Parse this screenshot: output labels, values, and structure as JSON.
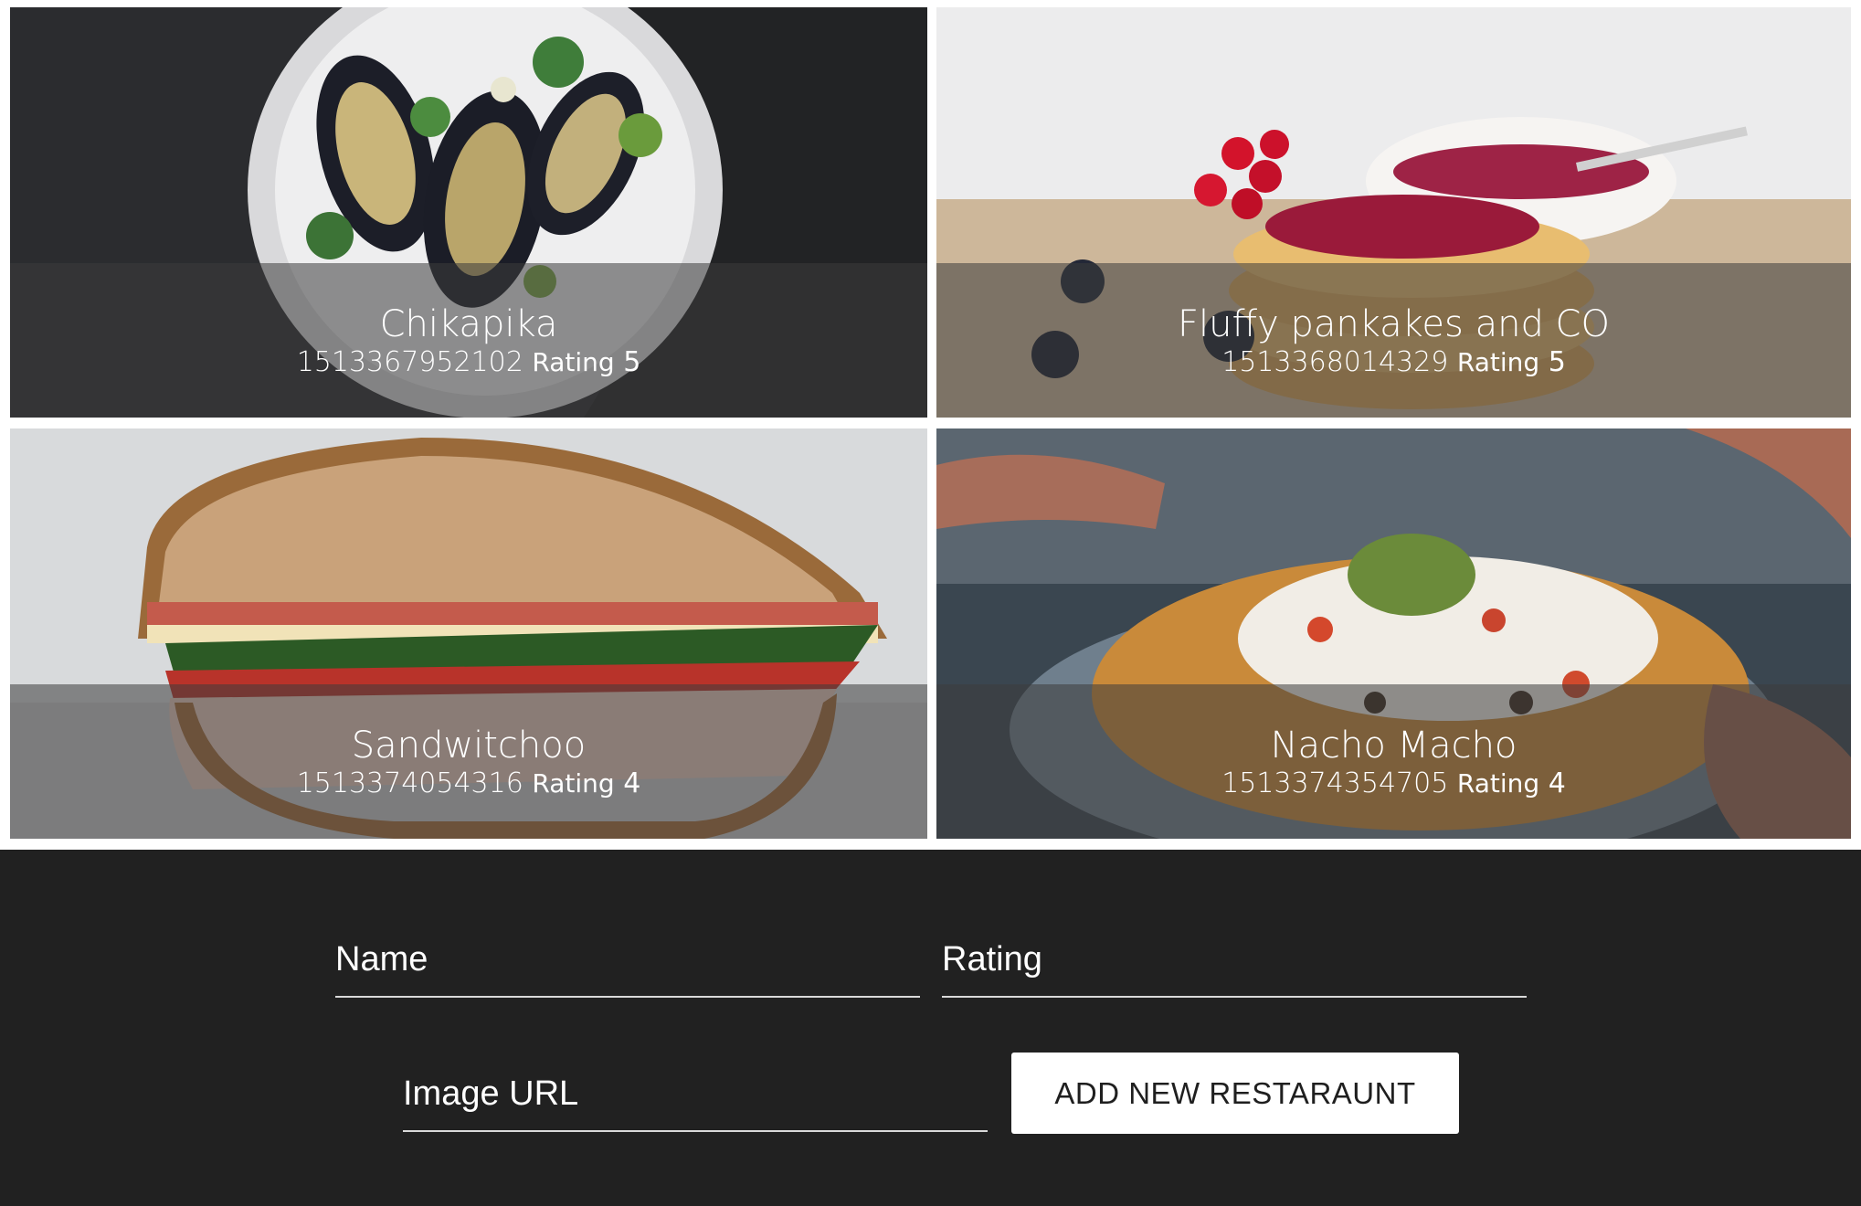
{
  "restaurants": [
    {
      "name": "Chikapika",
      "id": "1513367952102",
      "rating_label": "Rating",
      "rating": "5",
      "photo_icon": "mussels-dish-photo"
    },
    {
      "name": "Fluffy pankakes and CO",
      "id": "1513368014329",
      "rating_label": "Rating",
      "rating": "5",
      "photo_icon": "pancakes-photo"
    },
    {
      "name": "Sandwitchoo",
      "id": "1513374054316",
      "rating_label": "Rating",
      "rating": "4",
      "photo_icon": "sandwich-photo"
    },
    {
      "name": "Nacho Macho",
      "id": "1513374354705",
      "rating_label": "Rating",
      "rating": "4",
      "photo_icon": "nachos-photo"
    }
  ],
  "form": {
    "name_placeholder": "Name",
    "rating_placeholder": "Rating",
    "image_url_placeholder": "Image URL",
    "name_value": "",
    "rating_value": "",
    "image_url_value": "",
    "submit_label": "ADD NEW RESTARAUNT"
  },
  "colors": {
    "footer_background": "#212121",
    "button_background": "#ffffff",
    "text_light": "#ffffff"
  }
}
